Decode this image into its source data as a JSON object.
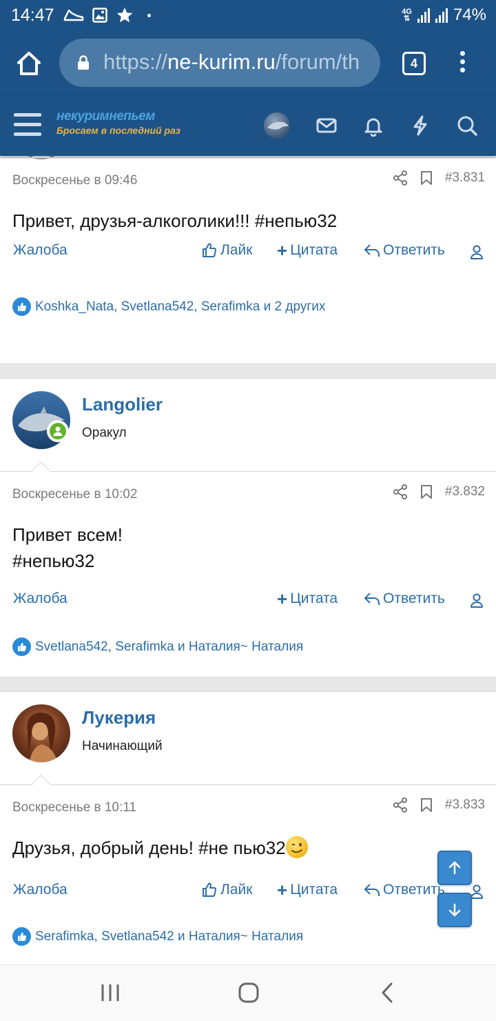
{
  "status_bar": {
    "time": "14:47",
    "network": "4G",
    "battery": "74%",
    "icons_left": [
      "sneaker-icon",
      "image-icon",
      "star-icon",
      "dot-icon"
    ]
  },
  "browser": {
    "url_scheme": "https://",
    "url_host": "ne-kurim.ru",
    "url_path": "/forum/th",
    "tabs_count": "4"
  },
  "site": {
    "logo_top": "некуримнепьем",
    "logo_bottom": "Бросаем в последний раз"
  },
  "posts": [
    {
      "date": "Воскресенье в 09:46",
      "number": "#3.831",
      "text_lines": [
        "Привет, друзья-алкоголики!!! #непью32"
      ],
      "actions": {
        "report": "Жалоба",
        "like": "Лайк",
        "quote": "Цитата",
        "reply": "Ответить"
      },
      "reactions": "Koshka_Nata, Svetlana542, Serafimka и 2 других"
    },
    {
      "username": "Langolier",
      "user_title": "Оракул",
      "date": "Воскресенье в 10:02",
      "number": "#3.832",
      "text_lines": [
        "Привет всем!",
        "#непью32"
      ],
      "actions": {
        "report": "Жалоба",
        "quote": "Цитата",
        "reply": "Ответить"
      },
      "reactions": "Svetlana542, Serafimka и Наталия~ Наталия"
    },
    {
      "username": "Лукерия",
      "user_title": "Начинающий",
      "date": "Воскресенье в 10:11",
      "number": "#3.833",
      "text_lines": [
        "Друзья, добрый день! #не пью32"
      ],
      "actions": {
        "report": "Жалоба",
        "like": "Лайк",
        "quote": "Цитата",
        "reply": "Ответить"
      },
      "reactions": "Serafimka, Svetlana542 и Наталия~ Наталия"
    }
  ],
  "colors": {
    "brand": "#1d5286",
    "link": "#2b6da8",
    "online": "#63b32e",
    "scroll_button": "#3a89cf"
  }
}
